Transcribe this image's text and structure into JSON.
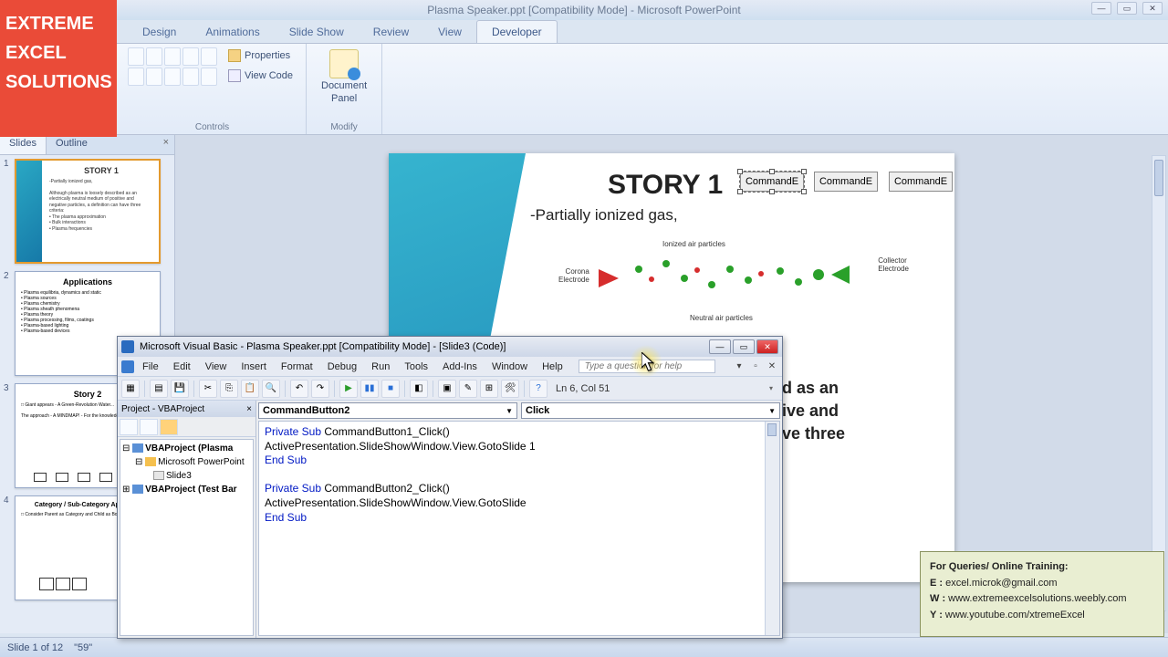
{
  "logo": {
    "line1": "EXTREME",
    "line2": "EXCEL",
    "line3": "SOLUTIONS"
  },
  "window": {
    "title": "Plasma Speaker.ppt [Compatibility Mode] - Microsoft PowerPoint"
  },
  "ribbon": {
    "tabs": [
      "Design",
      "Animations",
      "Slide Show",
      "Review",
      "View",
      "Developer"
    ],
    "active_tab": "Developer",
    "controls_group": "Controls",
    "modify_group": "Modify",
    "properties_btn": "Properties",
    "view_code_btn": "View Code",
    "doc_panel_btn1": "Document",
    "doc_panel_btn2": "Panel"
  },
  "side": {
    "tabs": [
      "Slides",
      "Outline"
    ],
    "active": "Slides",
    "thumbs": [
      {
        "num": "1",
        "title": "STORY 1",
        "body": "-Partially ionized gas,\n\nAlthough plasma is loosely described as an\nelectrically neutral medium of positive and\nnegative particles, a definition can have three\ncriteria:\n• The plasma approximation\n• Bulk interactions\n• Plasma frequencies"
      },
      {
        "num": "2",
        "title": "Applications",
        "body": "• Plasma equilibria, dynamics and static\n• Plasma sources\n• Plasma chemistry\n• Plasma sheath phenomena\n• Plasma theory\n• Plasma processing, films, coatings\n• Plasma-based lighting\n• Plasma-based devices"
      },
      {
        "num": "3",
        "title": "Story 2",
        "body": "□ Giant appears - A Green-Revolution Water...\n\nThe approach - A MINDMAP! - For the knowledge"
      },
      {
        "num": "4",
        "title": "Category / Sub-Category Approach",
        "body": "□ Consider Parent as Category and Child as Box"
      }
    ]
  },
  "slide": {
    "title": "STORY 1",
    "subtitle": "-Partially ionized gas,",
    "cmd_btns": [
      "CommandE",
      "CommandE",
      "CommandE"
    ],
    "diagram": {
      "left_label": "Corona\nElectrode",
      "top_label": "Ionized air particles",
      "right_label": "Collector\nElectrode",
      "bottom_label": "Neutral air particles"
    },
    "body_text": "ped as an\nsitive and\nhave three"
  },
  "vba": {
    "title": "Microsoft Visual Basic - Plasma Speaker.ppt [Compatibility Mode] - [Slide3 (Code)]",
    "menu": [
      "File",
      "Edit",
      "View",
      "Insert",
      "Format",
      "Debug",
      "Run",
      "Tools",
      "Add-Ins",
      "Window",
      "Help"
    ],
    "help_placeholder": "Type a question for help",
    "cursor_pos": "Ln 6, Col 51",
    "project_head": "Project - VBAProject",
    "tree": {
      "n1": "VBAProject (Plasma ",
      "n2": "Microsoft PowerPoint",
      "n3": "Slide3",
      "n4": "VBAProject (Test Bar"
    },
    "dd_object": "CommandButton2",
    "dd_proc": "Click",
    "code": {
      "l1a": "Private Sub",
      "l1b": " CommandButton1_Click()",
      "l2": "ActivePresentation.SlideShowWindow.View.GotoSlide 1",
      "l3": "End Sub",
      "l4a": "Private Sub",
      "l4b": " CommandButton2_Click()",
      "l5": "ActivePresentation.SlideShowWindow.View.GotoSlide",
      "l6": "End Sub"
    }
  },
  "status": {
    "slide_info": "Slide 1 of 12",
    "extra": "\"59\""
  },
  "info": {
    "head": "For Queries/ Online Training:",
    "e_label": "E  :",
    "e_val": " excel.microk@gmail.com",
    "w_label": "W :",
    "w_val": " www.extremeexcelsolutions.weebly.com",
    "y_label": "Y  :",
    "y_val": " www.youtube.com/xtremeExcel"
  }
}
